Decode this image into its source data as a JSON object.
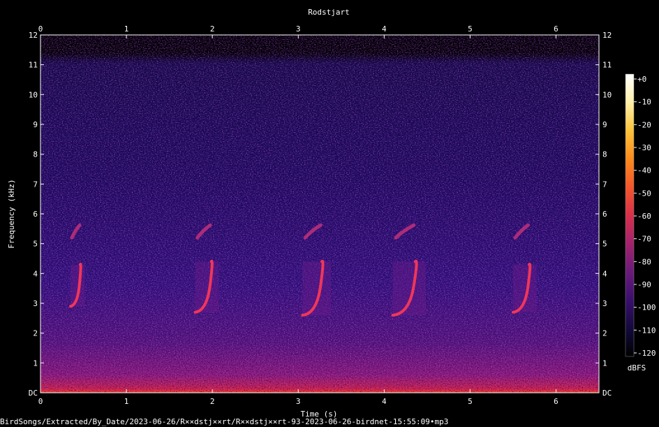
{
  "chart_data": {
    "type": "heatmap",
    "title": "Rodstjart",
    "xlabel": "Time (s)",
    "ylabel": "Frequency (kHz)",
    "xlim": [
      0,
      6.5
    ],
    "ylim": [
      0,
      12
    ],
    "x_ticks": [
      "0",
      "1",
      "2",
      "3",
      "4",
      "5",
      "6"
    ],
    "y_ticks": [
      "DC",
      "1",
      "2",
      "3",
      "4",
      "5",
      "6",
      "7",
      "8",
      "9",
      "10",
      "11",
      "12"
    ],
    "colorbar": {
      "label": "dBFS",
      "range": [
        -120,
        0
      ],
      "ticks": [
        "+0",
        "-10",
        "-20",
        "-30",
        "-40",
        "-50",
        "-60",
        "-70",
        "-80",
        "-90",
        "-100",
        "-110",
        "-120"
      ],
      "colors": [
        "#000000",
        "#140a3c",
        "#3a0f6e",
        "#6b1a7a",
        "#a3226c",
        "#d8304a",
        "#f4562a",
        "#fb8b1c",
        "#fcc33a",
        "#fdf0a8",
        "#ffffff"
      ]
    },
    "calls": [
      {
        "start": 0.35,
        "end": 0.5,
        "low_khz": 2.9,
        "high_khz": 4.3
      },
      {
        "start": 1.8,
        "end": 2.05,
        "low_khz": 2.7,
        "high_khz": 4.4
      },
      {
        "start": 3.05,
        "end": 3.35,
        "low_khz": 2.6,
        "high_khz": 4.4
      },
      {
        "start": 4.1,
        "end": 4.45,
        "low_khz": 2.6,
        "high_khz": 4.4
      },
      {
        "start": 5.5,
        "end": 5.75,
        "low_khz": 2.7,
        "high_khz": 4.3
      }
    ]
  },
  "footer": "BirdSongs/Extracted/By_Date/2023-06-26/R××dstj××rt/R××dstj××rt-93-2023-06-26-birdnet-15:55:09•mp3"
}
